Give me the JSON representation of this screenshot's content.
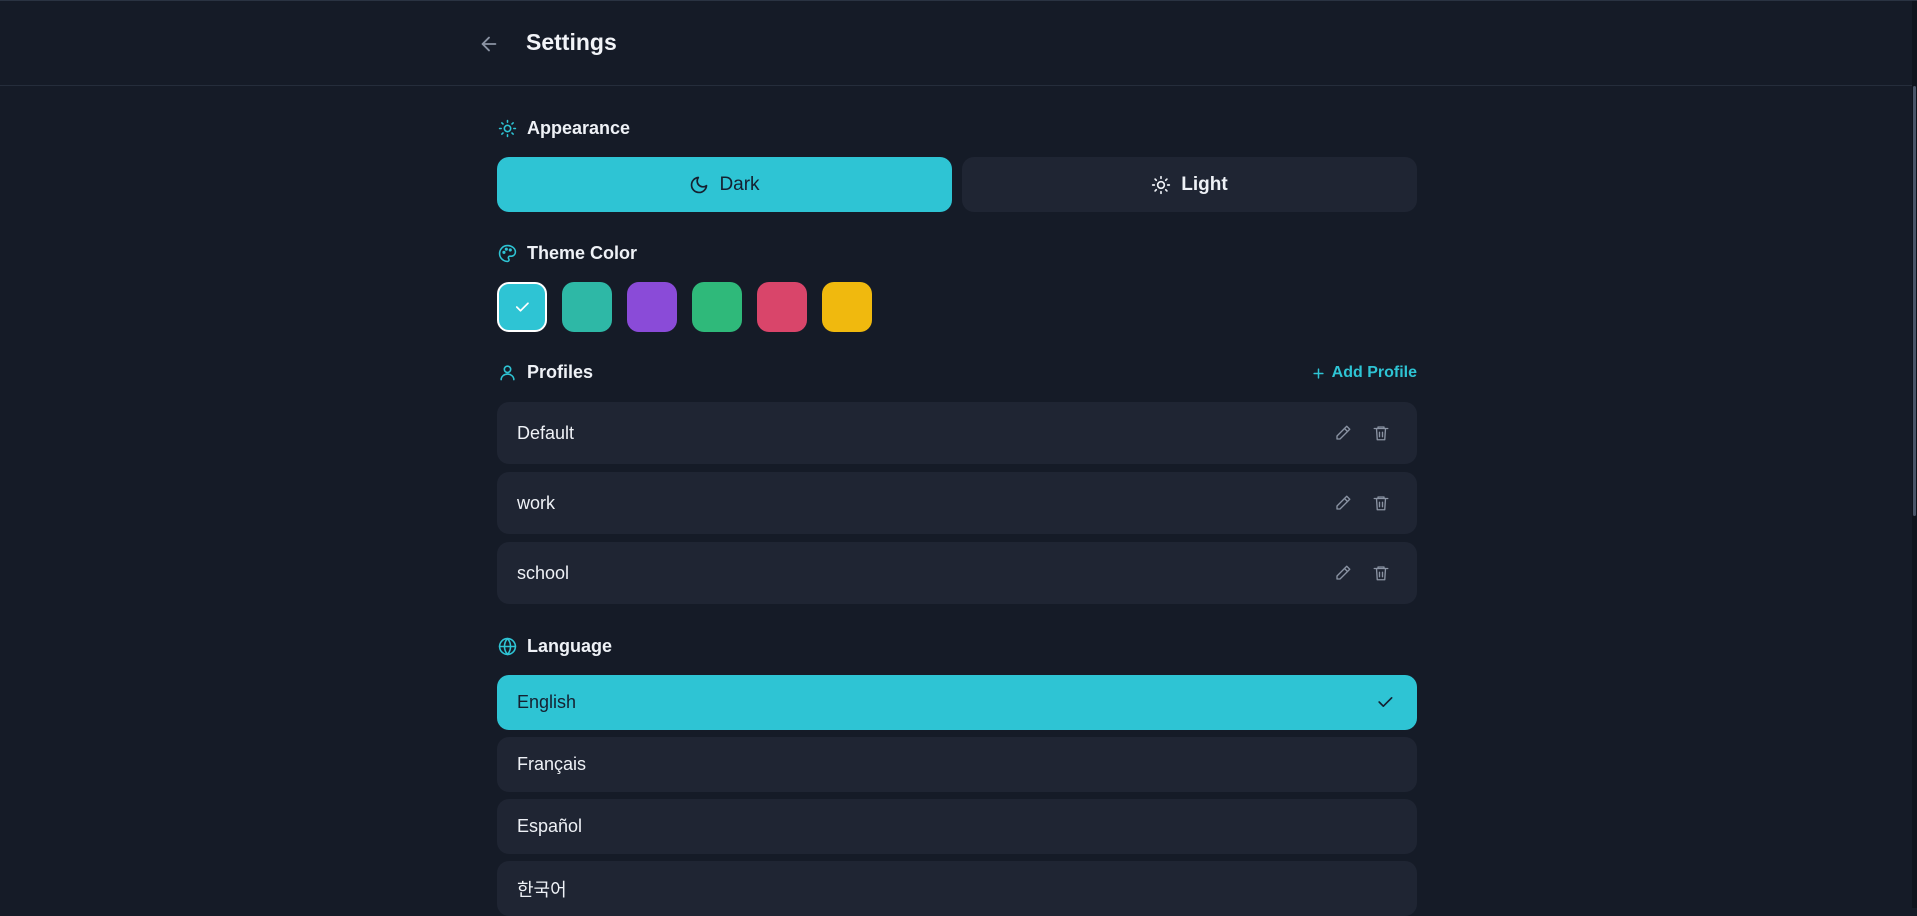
{
  "header": {
    "title": "Settings"
  },
  "appearance": {
    "heading": "Appearance",
    "modes": [
      {
        "label": "Dark",
        "icon": "moon-icon",
        "active": true
      },
      {
        "label": "Light",
        "icon": "sun-icon",
        "active": false
      }
    ]
  },
  "theme": {
    "heading": "Theme Color",
    "swatches": [
      "#2ec4d4",
      "#2eb8a6",
      "#8a4bd8",
      "#2fb97a",
      "#d9456a",
      "#f0b90e"
    ],
    "selected_index": 0
  },
  "profiles": {
    "heading": "Profiles",
    "add_label": "Add Profile",
    "items": [
      {
        "name": "Default"
      },
      {
        "name": "work"
      },
      {
        "name": "school"
      }
    ]
  },
  "language": {
    "heading": "Language",
    "items": [
      {
        "label": "English",
        "active": true
      },
      {
        "label": "Français",
        "active": false
      },
      {
        "label": "Español",
        "active": false
      },
      {
        "label": "한국어",
        "active": false
      }
    ]
  },
  "colors": {
    "accent": "#2ec4d4",
    "background": "#151b27",
    "card": "#1f2533"
  }
}
